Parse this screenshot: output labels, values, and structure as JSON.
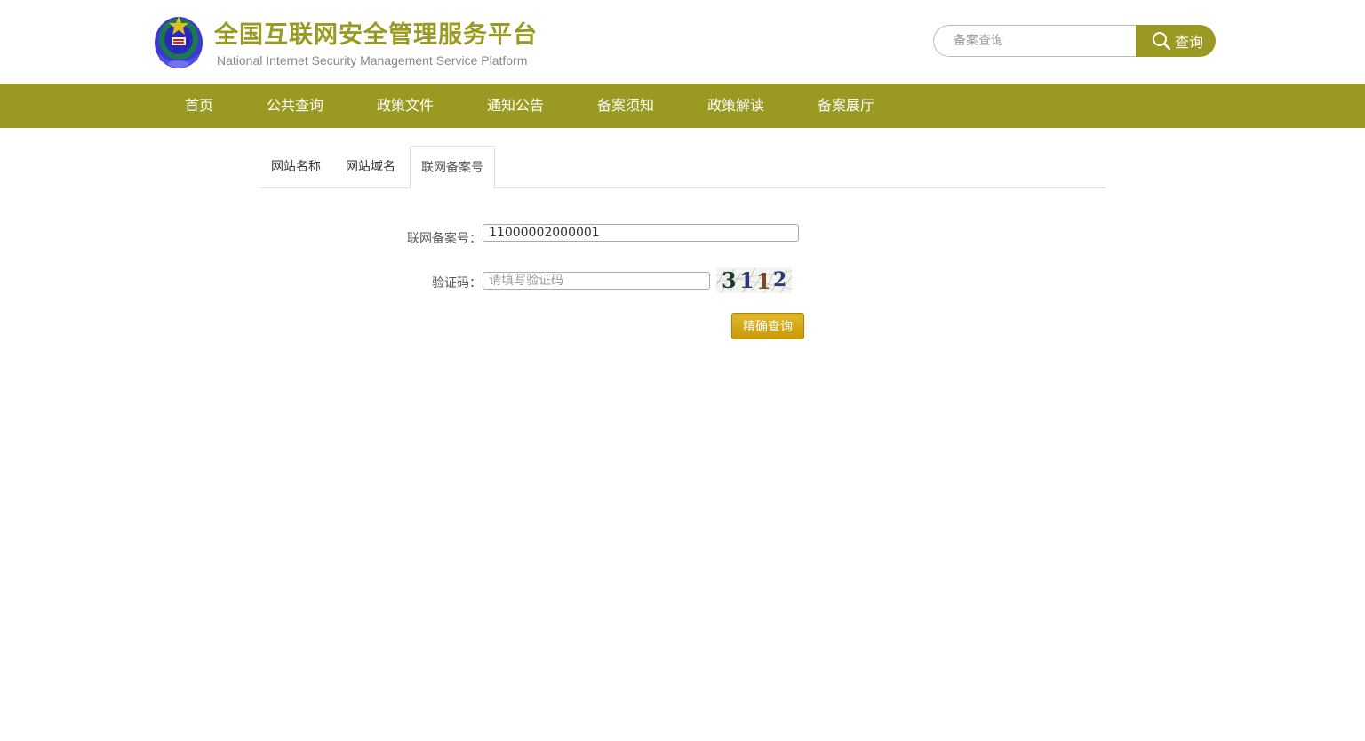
{
  "header": {
    "title": "全国互联网安全管理服务平台",
    "subtitle": "National Internet Security Management Service Platform",
    "search": {
      "placeholder": "备案查询",
      "button_label": "查询"
    }
  },
  "nav": {
    "items": [
      {
        "label": "首页"
      },
      {
        "label": "公共查询"
      },
      {
        "label": "政策文件"
      },
      {
        "label": "通知公告"
      },
      {
        "label": "备案须知"
      },
      {
        "label": "政策解读"
      },
      {
        "label": "备案展厅"
      }
    ]
  },
  "tabs": [
    {
      "label": "网站名称",
      "active": false
    },
    {
      "label": "网站域名",
      "active": false
    },
    {
      "label": "联网备案号",
      "active": true
    }
  ],
  "form": {
    "record_label": "联网备案号：",
    "record_value": "11000002000001",
    "captcha_label": "验证码：",
    "captcha_placeholder": "请填写验证码",
    "captcha_text": "3112",
    "submit_label": "精确查询"
  },
  "colors": {
    "brand": "#9a9a22",
    "button_gold": "#d4a818"
  }
}
